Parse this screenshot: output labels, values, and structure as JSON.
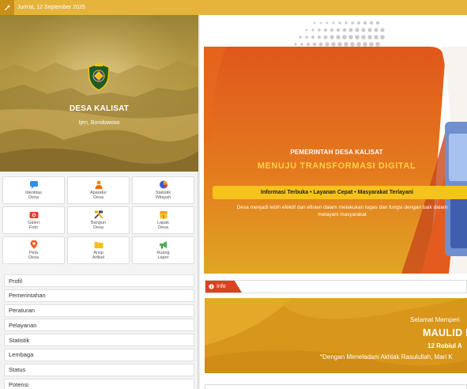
{
  "topbar": {
    "menu_icon": "wrench-icon",
    "date": "Jum'at, 12 September 2025",
    "color": "#e6b43a"
  },
  "hero": {
    "village_name": "DESA KALISAT",
    "region": "Ijen, Bondowoso"
  },
  "quick_links": [
    {
      "label": "Identitas\nDesa",
      "icon": "chat-icon",
      "color": "#2f8fe8"
    },
    {
      "label": "Aparatur\nDesa",
      "icon": "person-icon",
      "color": "#f28a1b"
    },
    {
      "label": "Statistik\nWilayah",
      "icon": "pie-chart-icon",
      "color": "#3b5bd6"
    },
    {
      "label": "Galeri\nFoto",
      "icon": "camera-icon",
      "color": "#e43a2e"
    },
    {
      "label": "Bangun\nDesa",
      "icon": "tools-icon",
      "color": "#444444"
    },
    {
      "label": "Lapak\nDesa",
      "icon": "shop-icon",
      "color": "#f2b21b"
    },
    {
      "label": "Peta\nDesa",
      "icon": "map-pin-icon",
      "color": "#f05a1d"
    },
    {
      "label": "Arsip\nArtikel",
      "icon": "folder-icon",
      "color": "#f2c21b"
    },
    {
      "label": "Ruang\nLapor",
      "icon": "megaphone-icon",
      "color": "#4caf50"
    }
  ],
  "menu": [
    "Profil",
    "Pemerintahan",
    "Peraturan",
    "Pelayanan",
    "Statistik",
    "Lembaga",
    "Status",
    "Potensi"
  ],
  "banner": {
    "subtitle": "PEMERINTAH DESA KALISAT",
    "title": "MENUJU TRANSFORMASI DIGITAL",
    "tagline": "Informasi Terbuka • Layanan Cepat • Masyarakat Terlayani",
    "desc_line1": "Desa menjadi lebih efektif dan efisien dalam melakukan tugas dan fungsi dengan baik dalam",
    "desc_line2": "melayani masyarakat"
  },
  "info": {
    "label": "Info",
    "icon": "info-icon"
  },
  "announcement": {
    "line1": "Selamat Memperi",
    "line2": "MAULID N",
    "line3": "12 Robiul A",
    "line4": "*Dengan Meneladani Akhlak Rasulullah, Mari K"
  }
}
